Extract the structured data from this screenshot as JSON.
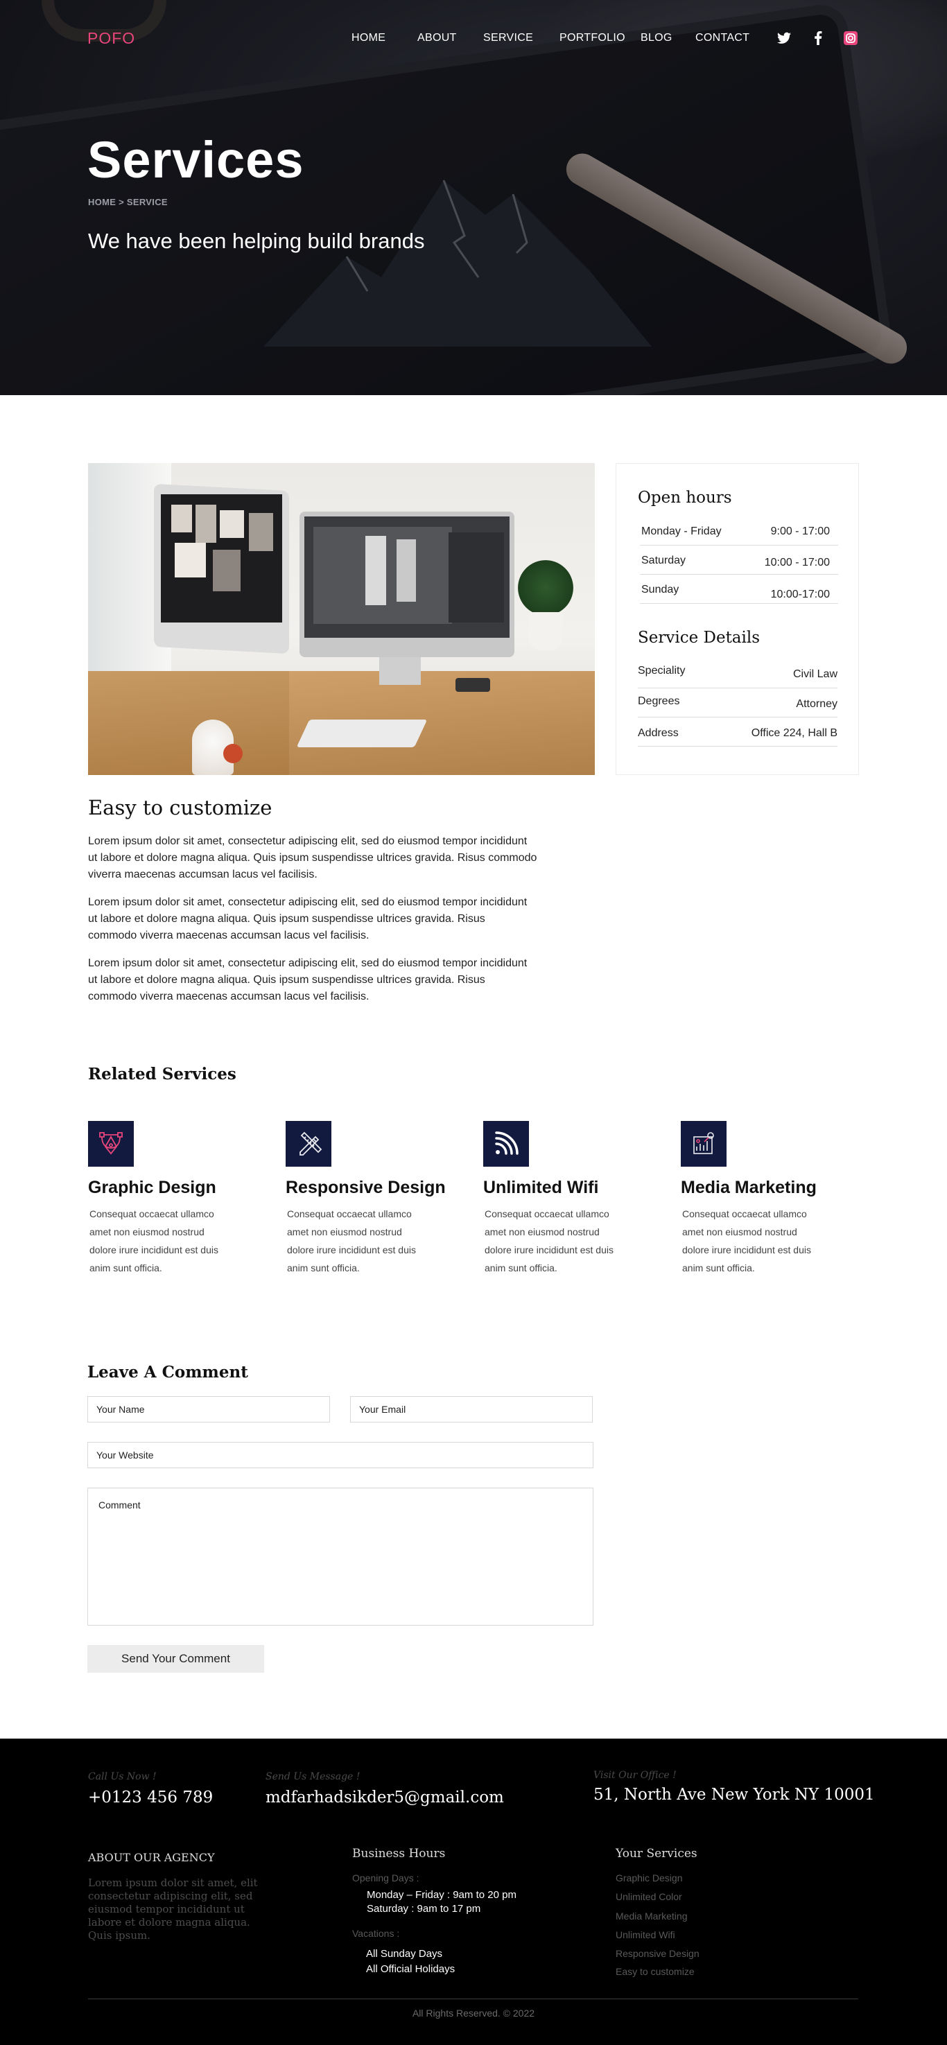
{
  "header": {
    "logo": "POFO",
    "nav": [
      "HOME",
      "ABOUT",
      "SERVICE",
      "PORTFOLIO",
      "BLOG",
      "CONTACT"
    ],
    "social": [
      {
        "icon": "twitter-icon"
      },
      {
        "icon": "facebook-icon"
      },
      {
        "icon": "instagram-icon",
        "color": "#e8457c"
      }
    ]
  },
  "hero": {
    "title": "Services",
    "breadcrumb": "HOME > SERVICE",
    "tagline": "We have been helping build brands"
  },
  "sidebar": {
    "hours_title": "Open hours",
    "hours": [
      {
        "day": "Monday - Friday",
        "time": "9:00 - 17:00"
      },
      {
        "day": "Saturday",
        "time": "10:00 - 17:00"
      },
      {
        "day": "Sunday",
        "time": "10:00-17:00"
      }
    ],
    "details_title": "Service Details",
    "details": [
      {
        "label": "Speciality",
        "value": "Civil Law"
      },
      {
        "label": "Degrees",
        "value": "Attorney"
      },
      {
        "label": "Address",
        "value": "Office 224, Hall B"
      }
    ]
  },
  "content": {
    "title": "Easy to customize",
    "paragraphs": [
      [
        "Lorem ipsum dolor sit amet, consectetur adipiscing elit, sed do eiusmod tempor incididunt",
        "ut labore et dolore magna aliqua. Quis ipsum suspendisse ultrices gravida. Risus commodo",
        "viverra maecenas accumsan lacus vel facilisis."
      ],
      [
        "Lorem ipsum dolor sit amet, consectetur adipiscing elit, sed do eiusmod tempor incididunt",
        "ut labore et dolore magna aliqua. Quis ipsum suspendisse ultrices gravida. Risus",
        "commodo viverra maecenas accumsan lacus vel facilisis."
      ],
      [
        "Lorem ipsum dolor sit amet, consectetur adipiscing elit, sed do eiusmod tempor incididunt",
        "ut labore et dolore magna aliqua. Quis ipsum suspendisse ultrices gravida. Risus",
        "commodo viverra maecenas accumsan lacus vel facilisis."
      ]
    ]
  },
  "related": {
    "title": "Related Services",
    "items": [
      {
        "icon": "pen-tool-icon",
        "title": "Graphic Design",
        "lines": [
          "Consequat occaecat ullamco",
          "amet non eiusmod nostrud",
          "dolore irure incididunt est duis",
          "anim sunt officia."
        ]
      },
      {
        "icon": "pencil-ruler-icon",
        "title": "Responsive Design",
        "lines": [
          "Consequat occaecat ullamco",
          "amet non eiusmod nostrud",
          "dolore irure incididunt est duis",
          "anim sunt officia."
        ]
      },
      {
        "icon": "wifi-icon",
        "title": "Unlimited Wifi",
        "lines": [
          "Consequat occaecat ullamco",
          "amet non eiusmod nostrud",
          "dolore irure incididunt est duis",
          "anim sunt officia."
        ]
      },
      {
        "icon": "marketing-chart-icon",
        "title": "Media Marketing",
        "lines": [
          "Consequat occaecat ullamco",
          "amet non eiusmod nostrud",
          "dolore irure incididunt est duis",
          "anim sunt officia."
        ]
      }
    ]
  },
  "comment": {
    "title": "Leave A Comment",
    "name_placeholder": "Your Name",
    "email_placeholder": "Your Email",
    "website_placeholder": "Your Website",
    "comment_placeholder": "Comment",
    "submit": "Send Your Comment"
  },
  "footer": {
    "call_label": "Call Us Now !",
    "phone": "+0123 456 789",
    "msg_label": "Send Us Message !",
    "email": "mdfarhadsikder5@gmail.com",
    "visit_label": "Visit Our Office !",
    "address": "51, North Ave New York NY 10001",
    "about_title": "ABOUT OUR AGENCY",
    "about_lines": [
      "Lorem ipsum dolor sit amet, elit",
      "consectetur adipiscing elit, sed",
      "eiusmod tempor incididunt ut",
      "labore et dolore magna aliqua.",
      "Quis ipsum."
    ],
    "hours_title": "Business Hours",
    "opening_label": "Opening Days :",
    "opening": [
      "Monday – Friday : 9am to 20 pm",
      "Saturday : 9am to 17 pm"
    ],
    "vacations_label": "Vacations :",
    "vacations": [
      "All Sunday Days",
      "All Official Holidays"
    ],
    "services_title": "Your  Services",
    "services": [
      "Graphic Design",
      "Unlimited Color",
      "Media Marketing",
      "Unlimited Wifi",
      "Responsive Design",
      "Easy to customize"
    ],
    "copyright": "All Rights Reserved. © 2022"
  },
  "colors": {
    "accent": "#e8457c",
    "icon_bg": "#121b3f",
    "footer_bg": "#000000"
  }
}
